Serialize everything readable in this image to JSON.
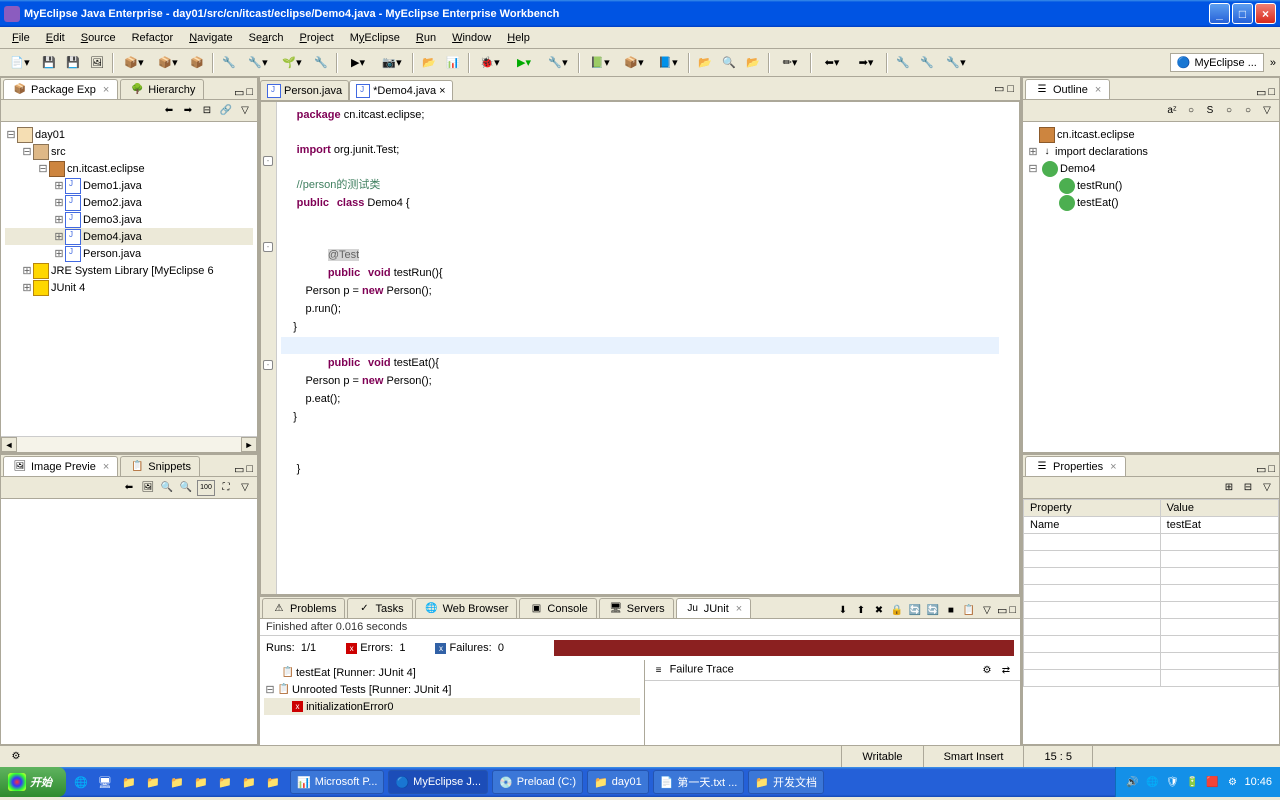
{
  "window": {
    "title": "MyEclipse Java Enterprise - day01/src/cn/itcast/eclipse/Demo4.java - MyEclipse Enterprise Workbench"
  },
  "menu": [
    "File",
    "Edit",
    "Source",
    "Refactor",
    "Navigate",
    "Search",
    "Project",
    "MyEclipse",
    "Run",
    "Window",
    "Help"
  ],
  "perspective": "MyEclipse ...",
  "views": {
    "package_explorer": {
      "title": "Package Exp",
      "hierarchy_title": "Hierarchy"
    },
    "image_preview": {
      "title": "Image Previe"
    },
    "snippets": {
      "title": "Snippets"
    },
    "outline": {
      "title": "Outline"
    },
    "properties": {
      "title": "Properties"
    }
  },
  "tree": {
    "project": "day01",
    "src": "src",
    "pkg": "cn.itcast.eclipse",
    "files": [
      "Demo1.java",
      "Demo2.java",
      "Demo3.java",
      "Demo4.java",
      "Person.java"
    ],
    "jre": "JRE System Library [MyEclipse 6",
    "junit": "JUnit 4"
  },
  "editor": {
    "tabs": [
      {
        "name": "Person.java",
        "dirty": false
      },
      {
        "name": "*Demo4.java",
        "dirty": true
      }
    ],
    "code": {
      "l1a": "package",
      "l1b": " cn.itcast.eclipse;",
      "l2a": "import",
      "l2b": " org.junit.Test;",
      "l3": "//person的测试类",
      "l4a": "public",
      "l4b": "class",
      "l4c": " Demo4 {",
      "l5": "@Test",
      "l6a": "public",
      "l6b": "void",
      "l6c": " testRun(){",
      "l7a": "        Person p = ",
      "l7b": "new",
      "l7c": " Person();",
      "l8": "        p.run();",
      "l9": "    }",
      "l10a": "public",
      "l10b": "void",
      "l10c": " testEat(){",
      "l11a": "        Person p = ",
      "l11b": "new",
      "l11c": " Person();",
      "l12": "        p.eat();",
      "l13": "    }",
      "l14": "}"
    }
  },
  "outline_tree": {
    "pkg": "cn.itcast.eclipse",
    "imports": "import declarations",
    "class": "Demo4",
    "methods": [
      "testRun()",
      "testEat()"
    ]
  },
  "properties": {
    "col1": "Property",
    "col2": "Value",
    "row": {
      "k": "Name",
      "v": "testEat"
    }
  },
  "bottom": {
    "tabs": [
      "Problems",
      "Tasks",
      "Web Browser",
      "Console",
      "Servers",
      "JUnit"
    ],
    "status": "Finished after 0.016 seconds",
    "runs_label": "Runs:",
    "runs": "1/1",
    "errors_label": "Errors:",
    "errors": "1",
    "failures_label": "Failures:",
    "failures": "0",
    "test_root": "testEat [Runner: JUnit 4]",
    "unrooted": "Unrooted Tests [Runner: JUnit 4]",
    "init_error": "initializationError0",
    "trace_label": "Failure Trace"
  },
  "status": {
    "writable": "Writable",
    "insert": "Smart Insert",
    "pos": "15 : 5"
  },
  "taskbar": {
    "start": "开始",
    "items": [
      "Microsoft P...",
      "MyEclipse J...",
      "Preload (C:)",
      "day01",
      "第一天.txt ...",
      "开发文档"
    ],
    "time": "10:46"
  }
}
